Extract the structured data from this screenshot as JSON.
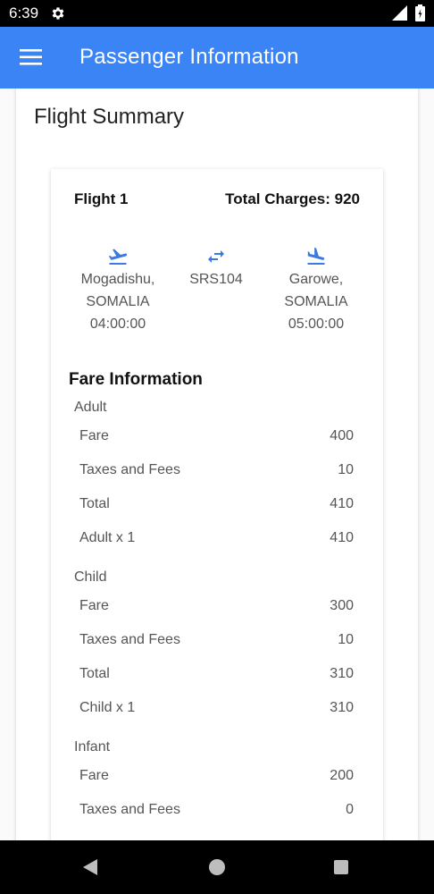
{
  "status_bar": {
    "time": "6:39",
    "icons": [
      "gear-icon",
      "signal-icon",
      "battery-icon"
    ]
  },
  "app_bar": {
    "title": "Passenger Information",
    "menu_icon": "menu-icon"
  },
  "summary": {
    "title": "Flight Summary"
  },
  "flight": {
    "name": "Flight 1",
    "total_charges": "Total Charges: 920",
    "origin": {
      "city": "Mogadishu,",
      "country": "SOMALIA",
      "time": "04:00:00",
      "icon": "flight-takeoff-icon"
    },
    "code": {
      "value": "SRS104",
      "icon": "swap-arrows-icon"
    },
    "destination": {
      "city": "Garowe,",
      "country": "SOMALIA",
      "time": "05:00:00",
      "icon": "flight-land-icon"
    }
  },
  "fare": {
    "heading": "Fare Information",
    "groups": [
      {
        "type": "Adult",
        "rows": [
          {
            "label": "Fare",
            "value": "400"
          },
          {
            "label": "Taxes and Fees",
            "value": "10"
          },
          {
            "label": "Total",
            "value": "410"
          },
          {
            "label": "Adult x 1",
            "value": "410"
          }
        ]
      },
      {
        "type": "Child",
        "rows": [
          {
            "label": "Fare",
            "value": "300"
          },
          {
            "label": "Taxes and Fees",
            "value": "10"
          },
          {
            "label": "Total",
            "value": "310"
          },
          {
            "label": "Child x 1",
            "value": "310"
          }
        ]
      },
      {
        "type": "Infant",
        "rows": [
          {
            "label": "Fare",
            "value": "200"
          },
          {
            "label": "Taxes and Fees",
            "value": "0"
          }
        ]
      }
    ]
  },
  "colors": {
    "primary": "#3b84f5",
    "status_bar": "#000000",
    "icon_blue": "#3b7ae0"
  },
  "nav_bar": {
    "icons": [
      "back-icon",
      "home-icon",
      "recent-apps-icon"
    ]
  }
}
